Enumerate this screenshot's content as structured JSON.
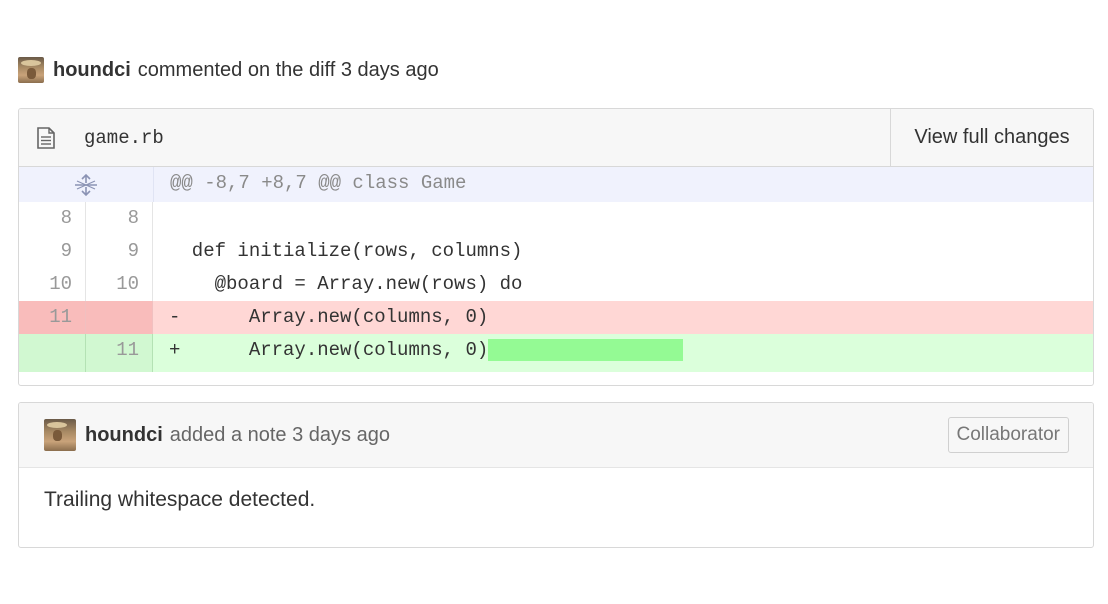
{
  "event": {
    "username": "houndci",
    "action_text": "commented on the diff 3 days ago"
  },
  "file": {
    "name": "game.rb",
    "view_button": "View full changes",
    "hunk_header": "@@ -8,7 +8,7 @@ class Game",
    "lines": [
      {
        "old": "8",
        "new": "8",
        "marker": "",
        "code": ""
      },
      {
        "old": "9",
        "new": "9",
        "marker": "",
        "code": "  def initialize(rows, columns)"
      },
      {
        "old": "10",
        "new": "10",
        "marker": "",
        "code": "    @board = Array.new(rows) do"
      },
      {
        "old": "11",
        "new": "",
        "marker": "-",
        "code": "      Array.new(columns, 0)"
      },
      {
        "old": "",
        "new": "11",
        "marker": "+",
        "code": "      Array.new(columns, 0)"
      }
    ]
  },
  "note": {
    "username": "houndci",
    "action_text": "added a note 3 days ago",
    "badge": "Collaborator",
    "body": "Trailing whitespace detected."
  },
  "colors": {
    "deletion_bg": "#ffd7d5",
    "addition_bg": "#dbffdb",
    "whitespace_highlight": "#94fa94",
    "hunk_bg": "#f0f2fd"
  }
}
